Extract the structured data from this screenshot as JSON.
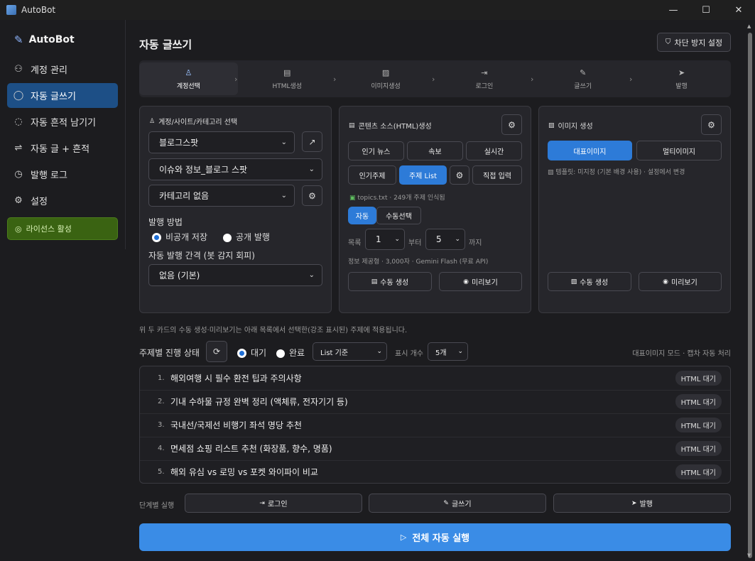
{
  "window": {
    "title": "AutoBot",
    "min": "—",
    "max": "☐",
    "close": "✕"
  },
  "sidebar": {
    "brand": "AutoBot",
    "items": [
      {
        "label": "계정 관리",
        "icon": "users-icon"
      },
      {
        "label": "자동 글쓰기",
        "icon": "chat-icon"
      },
      {
        "label": "자동 흔적 남기기",
        "icon": "comment-icon"
      },
      {
        "label": "자동 글 + 흔적",
        "icon": "flow-icon"
      },
      {
        "label": "발행 로그",
        "icon": "history-icon"
      },
      {
        "label": "설정",
        "icon": "gear-icon"
      }
    ],
    "license": "라이선스 활성"
  },
  "header": {
    "title": "자동 글쓰기",
    "block_btn": "차단 방지 설정"
  },
  "steps": [
    {
      "label": "계정선택"
    },
    {
      "label": "HTML생성"
    },
    {
      "label": "이미지생성"
    },
    {
      "label": "로그인"
    },
    {
      "label": "글쓰기"
    },
    {
      "label": "발행"
    }
  ],
  "card1": {
    "title": "계정/사이트/카테고리 선택",
    "account": "블로그스팟",
    "site": "이슈와 정보_블로그 스팟",
    "category": "카테고리 없음",
    "publish_method_label": "발행 방법",
    "private_label": "비공개 저장",
    "public_label": "공개 발행",
    "interval_label": "자동 발행 간격 (봇 감지 회피)",
    "interval_value": "없음 (기본)"
  },
  "card2": {
    "title": "콘텐츠 소스(HTML)생성",
    "buttons": [
      "인기 뉴스",
      "속보",
      "실시간",
      "인기주제",
      "주제 List",
      "직접 입력"
    ],
    "file_info": "topics.txt · 249개 주제 인식됨",
    "auto": "자동",
    "manual_select": "수동선택",
    "list_label": "목록",
    "from_value": "1",
    "from_label": "부터",
    "to_value": "5",
    "to_label": "까지",
    "model_info": "정보 제공형 · 3,000자 · Gemini Flash (무료 API)",
    "manual_gen": "수동 생성",
    "preview": "미리보기"
  },
  "card3": {
    "title": "이미지 생성",
    "main_image": "대표이미지",
    "multi_image": "멀티이미지",
    "template_info": "템플릿: 미지정 (기본 배경 사용) · 설정에서 변경",
    "manual_gen": "수동 생성",
    "preview": "미리보기"
  },
  "note": "위 두 카드의 수동 생성·미리보기는 아래 목록에서 선택한(강조 표시된) 주제에 적용됩니다.",
  "status": {
    "label": "주제별 진행 상태",
    "waiting": "대기",
    "done": "완료",
    "list_basis": "List 기준",
    "display_label": "표시 개수",
    "display_count": "5개",
    "mode_info": "대표이미지 모드 · 캡차 자동 처리"
  },
  "topics": [
    {
      "num": "1.",
      "text": "해외여행 시 필수 환전 팁과 주의사항",
      "badge": "HTML 대기"
    },
    {
      "num": "2.",
      "text": "기내 수하물 규정 완벽 정리 (액체류, 전자기기 등)",
      "badge": "HTML 대기"
    },
    {
      "num": "3.",
      "text": "국내선/국제선 비행기 좌석 명당 추천",
      "badge": "HTML 대기"
    },
    {
      "num": "4.",
      "text": "면세점 쇼핑 리스트 추천 (화장품, 향수, 명품)",
      "badge": "HTML 대기"
    },
    {
      "num": "5.",
      "text": "해외 유심 vs 로밍 vs 포켓 와이파이 비교",
      "badge": "HTML 대기"
    }
  ],
  "step_exec": {
    "label": "단계별 실행",
    "login": "로그인",
    "write": "글쓰기",
    "publish": "발행"
  },
  "run_all": "전체 자동 실행",
  "colors": {
    "accent": "#2d7bd8",
    "active_nav": "#1d4f86",
    "license": "#3a6312",
    "run": "#3a8ce6"
  }
}
